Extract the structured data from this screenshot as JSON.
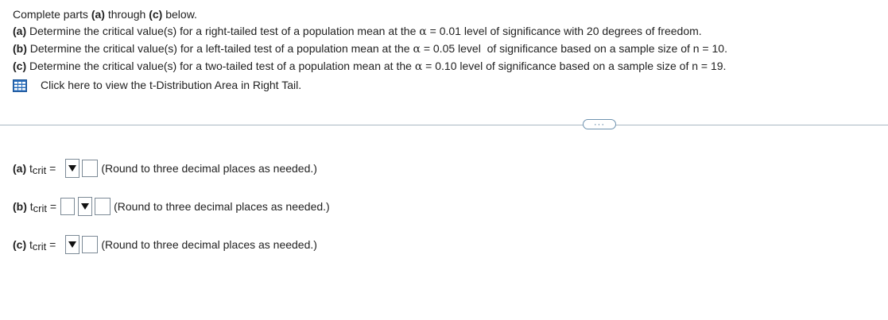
{
  "question": {
    "intro_pre": "Complete parts ",
    "intro_a": "(a)",
    "intro_mid": " through ",
    "intro_c": "(c)",
    "intro_post": " below.",
    "parts": [
      {
        "label": "(a)",
        "text_pre": "Determine the critical value(s) for a right-tailed test of a population mean at the ",
        "alpha": "α",
        "text_post": " = 0.01 level of significance with 20 degrees of freedom."
      },
      {
        "label": "(b)",
        "text_pre": "Determine the critical value(s) for a left-tailed test of a population mean at the ",
        "alpha": "α",
        "text_post": " = 0.05 level  of significance based on a sample size of n = 10."
      },
      {
        "label": "(c)",
        "text_pre": "Determine the critical value(s) for a two-tailed test of a population mean at the ",
        "alpha": "α",
        "text_post": " = 0.10 level of significance based on a sample size of n = 19."
      }
    ],
    "table_link": "Click here to view the t-Distribution Area in Right Tail."
  },
  "more_button": "···",
  "answers": [
    {
      "label": "(a)",
      "t": "t",
      "sub": "crit",
      "eq": " =",
      "note": "(Round to three decimal places as needed.)"
    },
    {
      "label": "(b)",
      "t": "t",
      "sub": "crit",
      "eq": " =",
      "note": "(Round to three decimal places as needed.)"
    },
    {
      "label": "(c)",
      "t": "t",
      "sub": "crit",
      "eq": " =",
      "note": "(Round to three decimal places as needed.)"
    }
  ],
  "colors": {
    "accent": "#3b6a92",
    "icon": "#2a6ebb",
    "divider": "#aab8c2"
  },
  "icons": {
    "table": "table-grid-icon",
    "dropdown": "triangle-down-icon"
  }
}
